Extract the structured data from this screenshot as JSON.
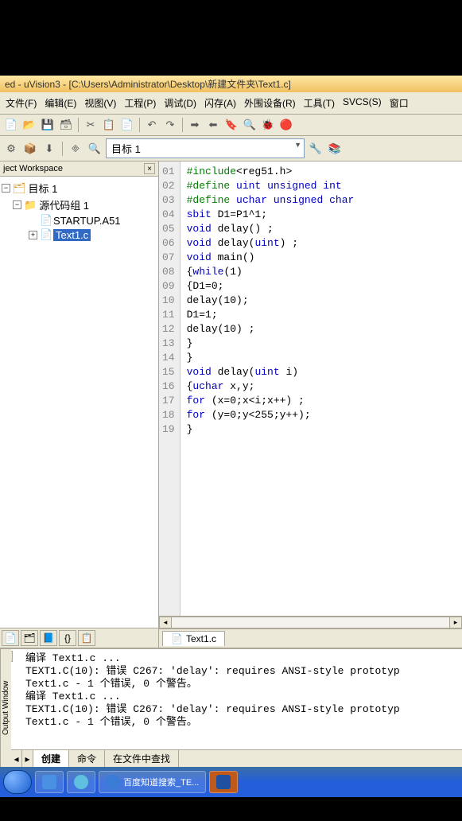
{
  "title": "ed - uVision3 - [C:\\Users\\Administrator\\Desktop\\新建文件夹\\Text1.c]",
  "menu": {
    "file": "文件(F)",
    "edit": "编辑(E)",
    "view": "视图(V)",
    "project": "工程(P)",
    "debug": "调试(D)",
    "flash": "闪存(A)",
    "peripherals": "外围设备(R)",
    "tools": "工具(T)",
    "svcs": "SVCS(S)",
    "window": "窗口"
  },
  "target_label": "目标 1",
  "workspace": {
    "title": "ject Workspace",
    "root": "目标 1",
    "group": "源代码组 1",
    "files": [
      "STARTUP.A51",
      "Text1.c"
    ],
    "selected": "Text1.c"
  },
  "code_lines": [
    "#include<reg51.h>",
    "#define uint unsigned int",
    "#define uchar unsigned char",
    "sbit D1=P1^1;",
    "void delay() ;",
    "void delay(uint) ;",
    "void main()",
    "{while(1)",
    "{D1=0;",
    "delay(10);",
    "D1=1;",
    "delay(10) ;",
    "}",
    "}",
    "void delay(uint i)",
    "{uchar x,y;",
    "for (x=0;x<i;x++) ;",
    "for (y=0;y<255;y++);",
    "}"
  ],
  "editor_tab": "Text1.c",
  "output": {
    "panel_label": "Output Window",
    "lines": [
      "编译 Text1.c ...",
      "TEXT1.C(10): 错误 C267: 'delay': requires ANSI-style prototyp",
      "Text1.c - 1 个错误, 0 个警告。",
      "编译 Text1.c ...",
      "TEXT1.C(10): 错误 C267: 'delay': requires ANSI-style prototyp",
      "Text1.c - 1 个错误, 0 个警告。"
    ],
    "tabs": {
      "build": "创建",
      "command": "命令",
      "find": "在文件中查找"
    }
  },
  "taskbar": {
    "ie_task": "百度知道搜索_TE..."
  }
}
